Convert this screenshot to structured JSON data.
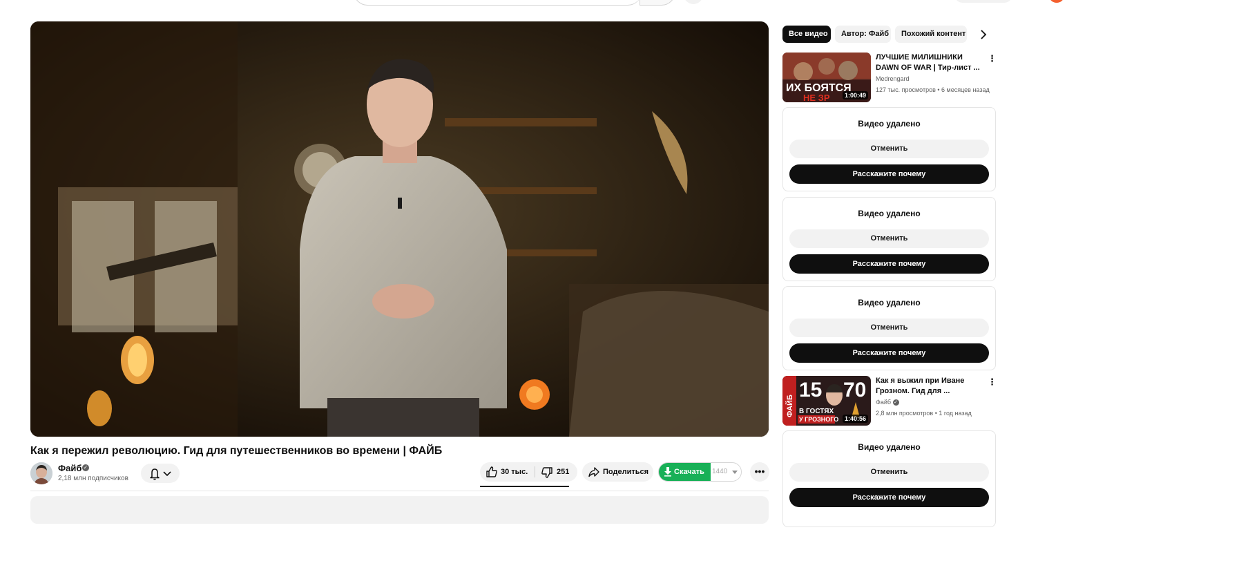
{
  "video": {
    "title": "Как я пережил революцию. Гид для путешественников во времени | ФАЙБ"
  },
  "channel": {
    "name": "Файб",
    "subscribers": "2,18 млн подписчиков"
  },
  "actions": {
    "likes": "30 тыс.",
    "dislikes": "251",
    "share_label": "Поделиться",
    "download_label": "Скачать",
    "download_quality": "1440",
    "download_color": "#18b057"
  },
  "chips": [
    {
      "label": "Все видео",
      "active": true
    },
    {
      "label": "Автор: Файб",
      "active": false
    },
    {
      "label": "Похожий контент",
      "active": false
    }
  ],
  "related": [
    {
      "title": "ЛУЧШИЕ МИЛИШНИКИ DAWN OF WAR | Тир-лист ...",
      "channel": "Medrengard",
      "meta": "127 тыс. просмотров • 6 месяцев назад",
      "duration": "1:00:49",
      "thumb_text_1": "ИХ БОЯТСЯ",
      "thumb_text_2": "НЕ ЗР"
    },
    {
      "title": "Как я выжил при Иване Грозном. Гид для ...",
      "channel": "Файб",
      "meta": "2,8 млн просмотров • 1 год назад",
      "duration": "1:40:56",
      "thumb_text_1": "15",
      "thumb_text_2": "70",
      "thumb_text_3": "В ГОСТЯХ",
      "thumb_text_4": "У ГРОЗНОГО",
      "thumb_text_5": "ФАЙБ"
    }
  ],
  "removed": {
    "title": "Видео удалено",
    "undo": "Отменить",
    "tell": "Расскажите почему"
  }
}
